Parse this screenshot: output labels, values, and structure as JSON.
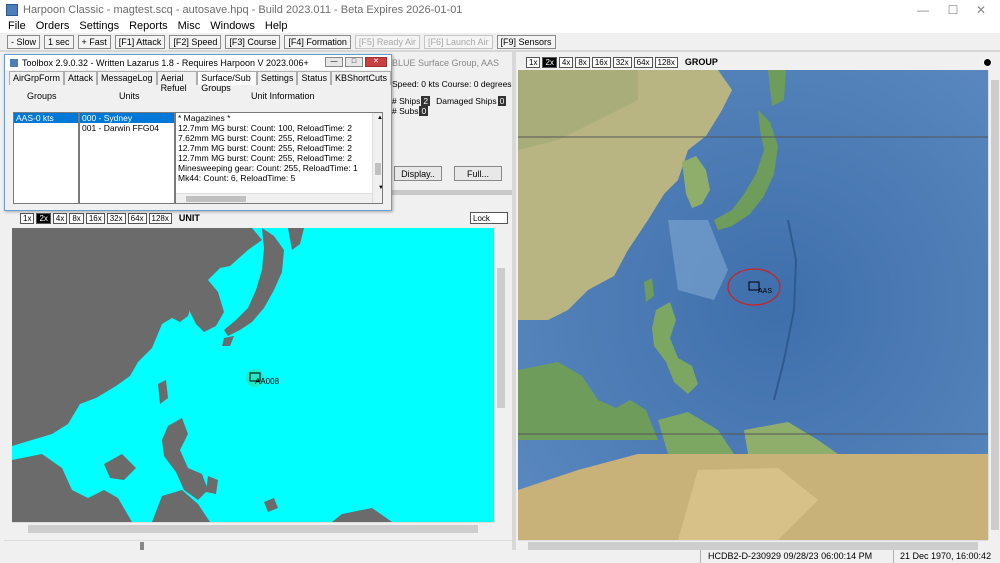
{
  "window": {
    "title": "Harpoon Classic - magtest.scq - autosave.hpq - Build 2023.011 - Beta Expires 2026-01-01"
  },
  "menu": [
    "File",
    "Orders",
    "Settings",
    "Reports",
    "Misc",
    "Windows",
    "Help"
  ],
  "toolbar": {
    "buttons": [
      {
        "label": "- Slow",
        "enabled": true
      },
      {
        "label": "1 sec",
        "enabled": true
      },
      {
        "label": "+ Fast",
        "enabled": true
      },
      {
        "label": "[F1] Attack",
        "enabled": true
      },
      {
        "label": "[F2] Speed",
        "enabled": true
      },
      {
        "label": "[F3] Course",
        "enabled": true
      },
      {
        "label": "[F4] Formation",
        "enabled": true
      },
      {
        "label": "[F5] Ready Air",
        "enabled": false
      },
      {
        "label": "[F6] Launch Air",
        "enabled": false
      },
      {
        "label": "[F9] Sensors",
        "enabled": true
      }
    ]
  },
  "group_info": {
    "header": "BLUE Surface Group, AAS",
    "speed_course": "Speed: 0 kts   Course: 0 degrees",
    "ships_label": "# Ships",
    "ships_count": "2",
    "damaged_label": "Damaged Ships",
    "damaged_count": "0",
    "subs_label": "# Subs",
    "subs_count": "0",
    "display_button": "Display..",
    "full_button": "Full..."
  },
  "toolbox": {
    "title": "Toolbox 2.9.0.32 - Written Lazarus 1.8 - Requires Harpoon V 2023.006+",
    "tabs": [
      "AirGrpForm",
      "Attack",
      "MessageLog",
      "Aerial Refuel",
      "Surface/Sub Groups",
      "Settings",
      "Status",
      "KBShortCuts"
    ],
    "active_tab": 4,
    "col_groups": "Groups",
    "col_units": "Units",
    "col_info": "Unit Information",
    "groups": [
      "AAS-0 kts"
    ],
    "units": [
      "000 - Sydney",
      "001 - Darwin FFG04"
    ],
    "info_lines": [
      "* Magazines *",
      "12.7mm MG burst: Count: 100, ReloadTime: 2",
      "7.62mm MG burst: Count: 255, ReloadTime: 2",
      "12.7mm MG burst: Count: 255, ReloadTime: 2",
      "12.7mm MG burst: Count: 255, ReloadTime: 2",
      "Minesweeping gear: Count: 255, ReloadTime: 1",
      "Mk44: Count: 6, ReloadTime: 5"
    ]
  },
  "left_map": {
    "zooms": [
      "1x",
      "2x",
      "4x",
      "8x",
      "16x",
      "32x",
      "64x",
      "128x"
    ],
    "selected_zoom": "2x",
    "view_label": "UNIT",
    "lock_button": "Lock",
    "unit_label": "AA008",
    "water_color": "#00ffff",
    "land_color": "#6b6b6b"
  },
  "right_map": {
    "zooms": [
      "1x",
      "2x",
      "4x",
      "8x",
      "16x",
      "32x",
      "64x",
      "128x"
    ],
    "selected_zoom": "2x",
    "view_label": "GROUP",
    "unit_label": "AAS",
    "ring_color": "#cc2222"
  },
  "status": {
    "build": "HCDB2-D-230929 09/28/23 06:00:14 PM",
    "game_time": "21 Dec 1970, 16:00:42"
  }
}
